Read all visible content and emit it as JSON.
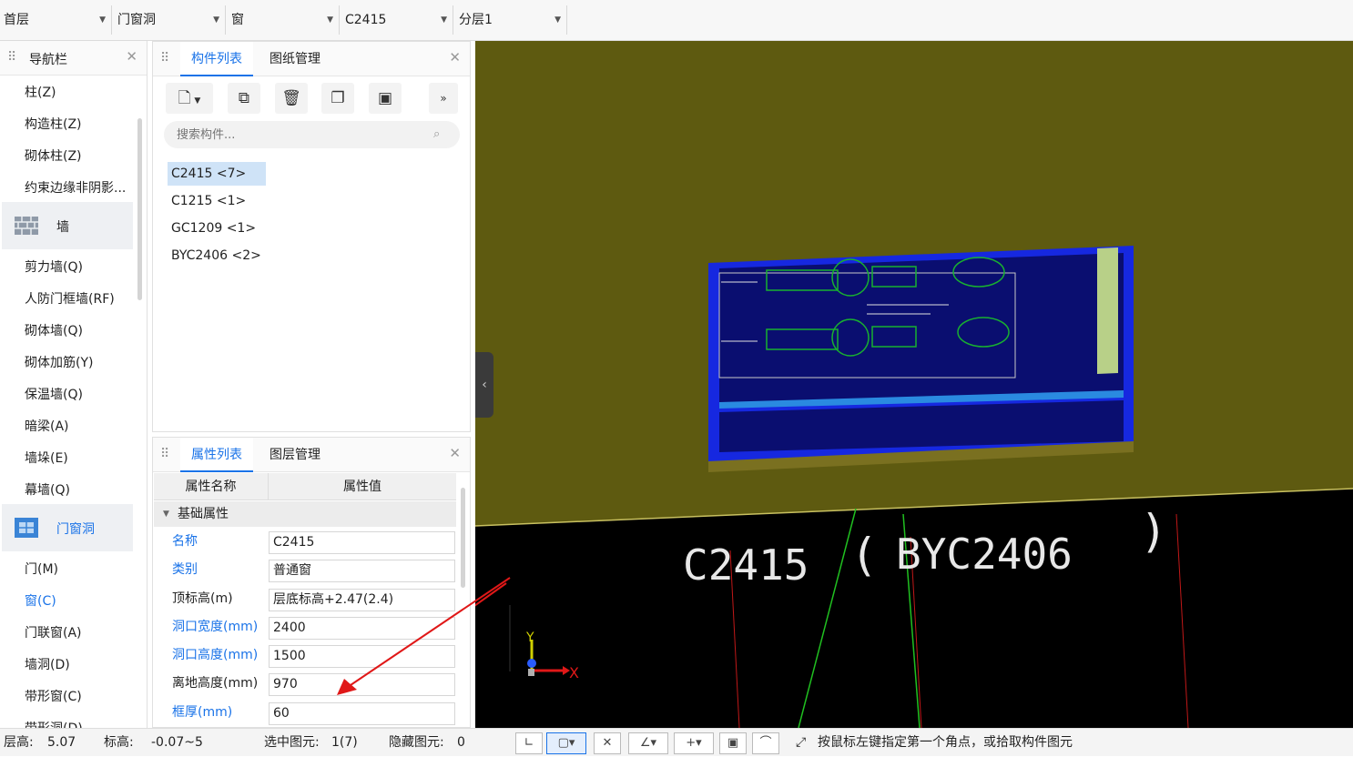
{
  "topbar": {
    "floor": "首层",
    "category": "门窗洞",
    "type": "窗",
    "component": "C2415",
    "layer": "分层1"
  },
  "nav": {
    "title": "导航栏",
    "items": [
      "柱(Z)",
      "构造柱(Z)",
      "砌体柱(Z)",
      "约束边缘非阴影...",
      "剪力墙(Q)",
      "人防门框墙(RF)",
      "砌体墙(Q)",
      "砌体加筋(Y)",
      "保温墙(Q)",
      "暗梁(A)",
      "墙垛(E)",
      "幕墙(Q)",
      "门(M)",
      "窗(C)",
      "门联窗(A)",
      "墙洞(D)",
      "带形窗(C)",
      "带形洞(D)"
    ],
    "group_wall": "墙",
    "group_opening": "门窗洞"
  },
  "components": {
    "tab_list": "构件列表",
    "tab_drawings": "图纸管理",
    "search_placeholder": "搜索构件...",
    "items": [
      "C2415 <7>",
      "C1215 <1>",
      "GC1209 <1>",
      "BYC2406 <2>"
    ]
  },
  "properties": {
    "tab_list": "属性列表",
    "tab_layers": "图层管理",
    "col_name": "属性名称",
    "col_value": "属性值",
    "section": "基础属性",
    "rows": [
      {
        "name": "名称",
        "value": "C2415"
      },
      {
        "name": "类别",
        "value": "普通窗"
      },
      {
        "name": "顶标高(m)",
        "value": "层底标高+2.47(2.4)"
      },
      {
        "name": "洞口宽度(mm)",
        "value": "2400"
      },
      {
        "name": "洞口高度(mm)",
        "value": "1500"
      },
      {
        "name": "离地高度(mm)",
        "value": "970"
      },
      {
        "name": "框厚(mm)",
        "value": "60"
      }
    ]
  },
  "viewport": {
    "label_main": "C2415",
    "label_paren_open": "(",
    "label_secondary": "BYC2406",
    "label_paren_close": ")",
    "axis_x": "X",
    "axis_y": "Y"
  },
  "status": {
    "floor_height_label": "层高:",
    "floor_height": "5.07",
    "elev_label": "标高:",
    "elev": "-0.07~5",
    "selected_label": "选中图元:",
    "selected": "1(7)",
    "hidden_label": "隐藏图元:",
    "hidden": "0",
    "hint": "按鼠标左键指定第一个角点，或拾取构件图元"
  },
  "colors": {
    "accent": "#1a73e8",
    "viewport_bg": "#5e5a10"
  }
}
